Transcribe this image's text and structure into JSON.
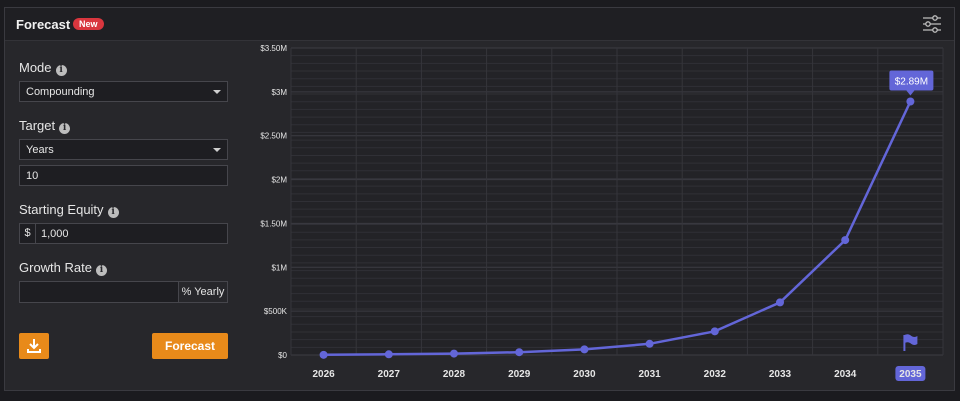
{
  "header": {
    "title": "Forecast",
    "badge": "New",
    "settings_icon": "sliders-icon"
  },
  "form": {
    "mode": {
      "label": "Mode",
      "value": "Compounding",
      "info_icon": "info-icon"
    },
    "target": {
      "label": "Target",
      "value": "Years",
      "years_value": "10",
      "info_icon": "info-icon"
    },
    "starting_equity": {
      "label": "Starting Equity",
      "prefix": "$",
      "value": "1,000",
      "info_icon": "info-icon"
    },
    "growth_rate": {
      "label": "Growth Rate",
      "value": "",
      "suffix": "% Yearly",
      "info_icon": "info-icon"
    },
    "download_button": {
      "icon": "download-icon"
    },
    "forecast_button": {
      "label": "Forecast"
    }
  },
  "colors": {
    "accent": "#e88a1a",
    "line": "#6366d8",
    "badge": "#d9363e"
  },
  "chart_data": {
    "type": "line",
    "x": [
      "2026",
      "2027",
      "2028",
      "2029",
      "2030",
      "2031",
      "2032",
      "2033",
      "2034",
      "2035"
    ],
    "values": [
      2000,
      8000,
      16000,
      32000,
      64000,
      128000,
      270000,
      600000,
      1310000,
      2890000
    ],
    "y_ticks": [
      "$0",
      "$500K",
      "$1M",
      "$1.50M",
      "$2M",
      "$2.50M",
      "$3M",
      "$3.50M"
    ],
    "ylim": [
      0,
      3500000
    ],
    "grid": true,
    "annotation": {
      "text": "$2.89M",
      "x": "2035"
    },
    "highlight_x": "2035",
    "end_marker_icon": "flag-icon"
  }
}
